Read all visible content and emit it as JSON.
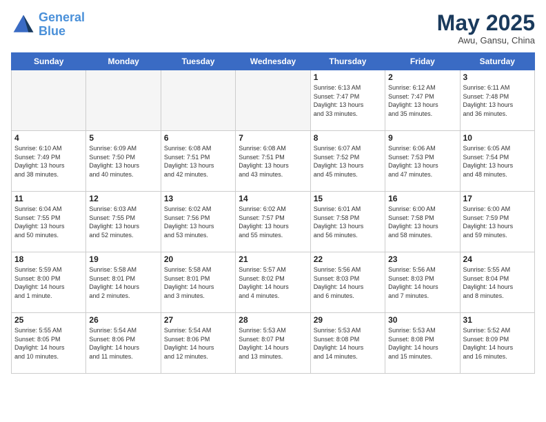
{
  "header": {
    "logo_general": "General",
    "logo_blue": "Blue",
    "month": "May 2025",
    "location": "Awu, Gansu, China"
  },
  "weekdays": [
    "Sunday",
    "Monday",
    "Tuesday",
    "Wednesday",
    "Thursday",
    "Friday",
    "Saturday"
  ],
  "weeks": [
    [
      {
        "day": "",
        "info": ""
      },
      {
        "day": "",
        "info": ""
      },
      {
        "day": "",
        "info": ""
      },
      {
        "day": "",
        "info": ""
      },
      {
        "day": "1",
        "info": "Sunrise: 6:13 AM\nSunset: 7:47 PM\nDaylight: 13 hours\nand 33 minutes."
      },
      {
        "day": "2",
        "info": "Sunrise: 6:12 AM\nSunset: 7:47 PM\nDaylight: 13 hours\nand 35 minutes."
      },
      {
        "day": "3",
        "info": "Sunrise: 6:11 AM\nSunset: 7:48 PM\nDaylight: 13 hours\nand 36 minutes."
      }
    ],
    [
      {
        "day": "4",
        "info": "Sunrise: 6:10 AM\nSunset: 7:49 PM\nDaylight: 13 hours\nand 38 minutes."
      },
      {
        "day": "5",
        "info": "Sunrise: 6:09 AM\nSunset: 7:50 PM\nDaylight: 13 hours\nand 40 minutes."
      },
      {
        "day": "6",
        "info": "Sunrise: 6:08 AM\nSunset: 7:51 PM\nDaylight: 13 hours\nand 42 minutes."
      },
      {
        "day": "7",
        "info": "Sunrise: 6:08 AM\nSunset: 7:51 PM\nDaylight: 13 hours\nand 43 minutes."
      },
      {
        "day": "8",
        "info": "Sunrise: 6:07 AM\nSunset: 7:52 PM\nDaylight: 13 hours\nand 45 minutes."
      },
      {
        "day": "9",
        "info": "Sunrise: 6:06 AM\nSunset: 7:53 PM\nDaylight: 13 hours\nand 47 minutes."
      },
      {
        "day": "10",
        "info": "Sunrise: 6:05 AM\nSunset: 7:54 PM\nDaylight: 13 hours\nand 48 minutes."
      }
    ],
    [
      {
        "day": "11",
        "info": "Sunrise: 6:04 AM\nSunset: 7:55 PM\nDaylight: 13 hours\nand 50 minutes."
      },
      {
        "day": "12",
        "info": "Sunrise: 6:03 AM\nSunset: 7:55 PM\nDaylight: 13 hours\nand 52 minutes."
      },
      {
        "day": "13",
        "info": "Sunrise: 6:02 AM\nSunset: 7:56 PM\nDaylight: 13 hours\nand 53 minutes."
      },
      {
        "day": "14",
        "info": "Sunrise: 6:02 AM\nSunset: 7:57 PM\nDaylight: 13 hours\nand 55 minutes."
      },
      {
        "day": "15",
        "info": "Sunrise: 6:01 AM\nSunset: 7:58 PM\nDaylight: 13 hours\nand 56 minutes."
      },
      {
        "day": "16",
        "info": "Sunrise: 6:00 AM\nSunset: 7:58 PM\nDaylight: 13 hours\nand 58 minutes."
      },
      {
        "day": "17",
        "info": "Sunrise: 6:00 AM\nSunset: 7:59 PM\nDaylight: 13 hours\nand 59 minutes."
      }
    ],
    [
      {
        "day": "18",
        "info": "Sunrise: 5:59 AM\nSunset: 8:00 PM\nDaylight: 14 hours\nand 1 minute."
      },
      {
        "day": "19",
        "info": "Sunrise: 5:58 AM\nSunset: 8:01 PM\nDaylight: 14 hours\nand 2 minutes."
      },
      {
        "day": "20",
        "info": "Sunrise: 5:58 AM\nSunset: 8:01 PM\nDaylight: 14 hours\nand 3 minutes."
      },
      {
        "day": "21",
        "info": "Sunrise: 5:57 AM\nSunset: 8:02 PM\nDaylight: 14 hours\nand 4 minutes."
      },
      {
        "day": "22",
        "info": "Sunrise: 5:56 AM\nSunset: 8:03 PM\nDaylight: 14 hours\nand 6 minutes."
      },
      {
        "day": "23",
        "info": "Sunrise: 5:56 AM\nSunset: 8:03 PM\nDaylight: 14 hours\nand 7 minutes."
      },
      {
        "day": "24",
        "info": "Sunrise: 5:55 AM\nSunset: 8:04 PM\nDaylight: 14 hours\nand 8 minutes."
      }
    ],
    [
      {
        "day": "25",
        "info": "Sunrise: 5:55 AM\nSunset: 8:05 PM\nDaylight: 14 hours\nand 10 minutes."
      },
      {
        "day": "26",
        "info": "Sunrise: 5:54 AM\nSunset: 8:06 PM\nDaylight: 14 hours\nand 11 minutes."
      },
      {
        "day": "27",
        "info": "Sunrise: 5:54 AM\nSunset: 8:06 PM\nDaylight: 14 hours\nand 12 minutes."
      },
      {
        "day": "28",
        "info": "Sunrise: 5:53 AM\nSunset: 8:07 PM\nDaylight: 14 hours\nand 13 minutes."
      },
      {
        "day": "29",
        "info": "Sunrise: 5:53 AM\nSunset: 8:08 PM\nDaylight: 14 hours\nand 14 minutes."
      },
      {
        "day": "30",
        "info": "Sunrise: 5:53 AM\nSunset: 8:08 PM\nDaylight: 14 hours\nand 15 minutes."
      },
      {
        "day": "31",
        "info": "Sunrise: 5:52 AM\nSunset: 8:09 PM\nDaylight: 14 hours\nand 16 minutes."
      }
    ]
  ]
}
